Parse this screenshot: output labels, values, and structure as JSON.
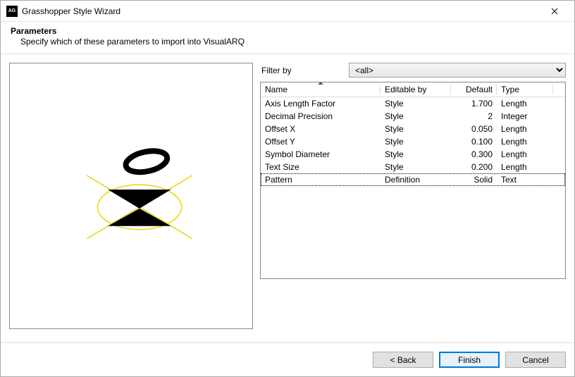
{
  "window": {
    "title": "Grasshopper Style Wizard",
    "app_icon_text": "AG"
  },
  "header": {
    "title": "Parameters",
    "subtitle": "Specify which of these parameters to import into VisualARQ"
  },
  "filter": {
    "label": "Filter by",
    "value": "<all>",
    "options": [
      "<all>"
    ]
  },
  "table": {
    "columns": {
      "name": "Name",
      "editable_by": "Editable by",
      "default": "Default",
      "type": "Type"
    },
    "rows": [
      {
        "name": "Axis Length Factor",
        "editable_by": "Style",
        "default": "1.700",
        "type": "Length",
        "selected": false
      },
      {
        "name": "Decimal Precision",
        "editable_by": "Style",
        "default": "2",
        "type": "Integer",
        "selected": false
      },
      {
        "name": "Offset X",
        "editable_by": "Style",
        "default": "0.050",
        "type": "Length",
        "selected": false
      },
      {
        "name": "Offset Y",
        "editable_by": "Style",
        "default": "0.100",
        "type": "Length",
        "selected": false
      },
      {
        "name": "Symbol Diameter",
        "editable_by": "Style",
        "default": "0.300",
        "type": "Length",
        "selected": false
      },
      {
        "name": "Text Size",
        "editable_by": "Style",
        "default": "0.200",
        "type": "Length",
        "selected": false
      },
      {
        "name": "Pattern",
        "editable_by": "Definition",
        "default": "Solid",
        "type": "Text",
        "selected": true
      }
    ]
  },
  "buttons": {
    "back": "< Back",
    "finish": "Finish",
    "cancel": "Cancel"
  }
}
